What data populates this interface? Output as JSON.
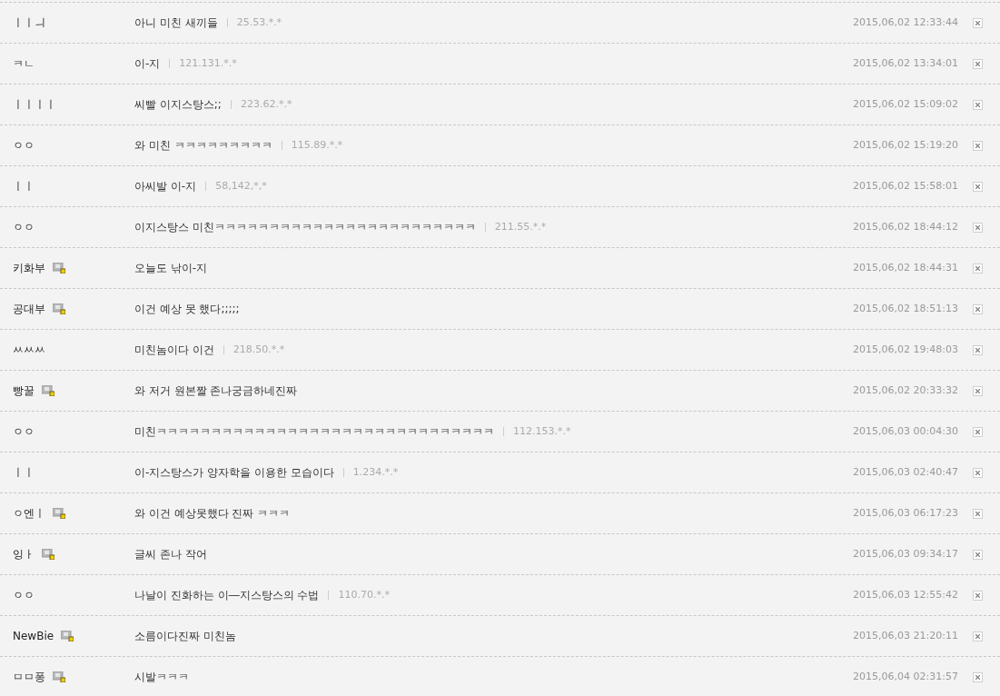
{
  "comments": [
    {
      "name": "ㅣㅣㅢ",
      "member": false,
      "text": "아니 미친 새끼들",
      "ip": "25.53.*.*",
      "date": "2015,06,02 12:33:44"
    },
    {
      "name": "ㅋㄴ",
      "member": false,
      "text": "이-지",
      "ip": "121.131.*.*",
      "date": "2015,06,02 13:34:01"
    },
    {
      "name": "ㅣㅣㅣㅣ",
      "member": false,
      "text": "씨빨 이지스탕스;;",
      "ip": "223.62.*.*",
      "date": "2015,06,02 15:09:02"
    },
    {
      "name": "ㅇㅇ",
      "member": false,
      "text": "와 미친 ㅋㅋㅋㅋㅋㅋㅋㅋㅋ",
      "ip": "115.89.*.*",
      "date": "2015,06,02 15:19:20"
    },
    {
      "name": "ㅣㅣ",
      "member": false,
      "text": "아씨발 이-지",
      "ip": "58,142,*,*",
      "date": "2015,06,02 15:58:01"
    },
    {
      "name": "ㅇㅇ",
      "member": false,
      "text": "이지스탕스 미친ㅋㅋㅋㅋㅋㅋㅋㅋㅋㅋㅋㅋㅋㅋㅋㅋㅋㅋㅋㅋㅋㅋㅋㅋ",
      "ip": "211.55.*.*",
      "date": "2015,06,02 18:44:12"
    },
    {
      "name": "키화부",
      "member": true,
      "text": "오늘도 낚이-지",
      "date": "2015,06,02 18:44:31"
    },
    {
      "name": "공대부",
      "member": true,
      "text": "이건 예상 못 했다;;;;;",
      "date": "2015,06,02 18:51:13"
    },
    {
      "name": "ㅆㅆㅆ",
      "member": false,
      "text": "미친놈이다 이건",
      "ip": "218.50.*.*",
      "date": "2015,06,02 19:48:03"
    },
    {
      "name": "빵꿀",
      "member": true,
      "text": "와 저거 원본짤 존나궁금하네진짜",
      "date": "2015,06,02 20:33:32"
    },
    {
      "name": "ㅇㅇ",
      "member": false,
      "text": "미친ㅋㅋㅋㅋㅋㅋㅋㅋㅋㅋㅋㅋㅋㅋㅋㅋㅋㅋㅋㅋㅋㅋㅋㅋㅋㅋㅋㅋㅋㅋㅋ",
      "ip": "112.153.*.*",
      "date": "2015,06,03 00:04:30"
    },
    {
      "name": "ㅣㅣ",
      "member": false,
      "text": "이-지스탕스가 양자학을 이용한 모습이다",
      "ip": "1.234.*.*",
      "date": "2015,06,03 02:40:47"
    },
    {
      "name": "ㅇ엔ㅣ",
      "member": true,
      "text": "와 이건 예상못했다 진짜 ㅋㅋㅋ",
      "date": "2015,06,03 06:17:23"
    },
    {
      "name": "잉ㅏ",
      "member": true,
      "text": "글씨 존나 작어",
      "date": "2015,06,03 09:34:17"
    },
    {
      "name": "ㅇㅇ",
      "member": false,
      "text": "나날이 진화하는 이―지스탕스의 수법",
      "ip": "110.70.*.*",
      "date": "2015,06,03 12:55:42"
    },
    {
      "name": "NewBie",
      "member": true,
      "text": "소름이다진짜 미친놈",
      "date": "2015,06,03 21:20:11"
    },
    {
      "name": "ㅁㅁ퐁",
      "member": true,
      "text": "시발ㅋㅋㅋ",
      "date": "2015,06,04 02:31:57"
    }
  ]
}
